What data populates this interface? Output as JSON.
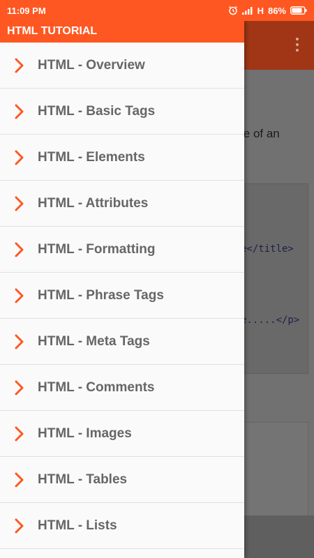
{
  "status_bar": {
    "time": "11:09 PM",
    "network": "H",
    "battery": "86%"
  },
  "drawer": {
    "title": "HTML TUTORIAL",
    "items": [
      {
        "label": "HTML - Overview"
      },
      {
        "label": "HTML - Basic Tags"
      },
      {
        "label": "HTML - Elements"
      },
      {
        "label": "HTML - Attributes"
      },
      {
        "label": "HTML - Formatting"
      },
      {
        "label": "HTML - Phrase Tags"
      },
      {
        "label": "HTML - Meta Tags"
      },
      {
        "label": "HTML - Comments"
      },
      {
        "label": "HTML - Images"
      },
      {
        "label": "HTML - Tables"
      },
      {
        "label": "HTML - Lists"
      }
    ]
  },
  "background": {
    "text_fragment": "le of an",
    "code_line_1": "e</title>",
    "code_line_2": "e.....</p>"
  },
  "colors": {
    "accent": "#ff5722",
    "chevron": "#ff5722",
    "item_text": "#666666"
  },
  "icons": {
    "overflow": "more-vert-icon",
    "chevron": "chevron-right-icon",
    "alarm": "alarm-icon",
    "signal": "signal-icon",
    "battery": "battery-icon"
  }
}
